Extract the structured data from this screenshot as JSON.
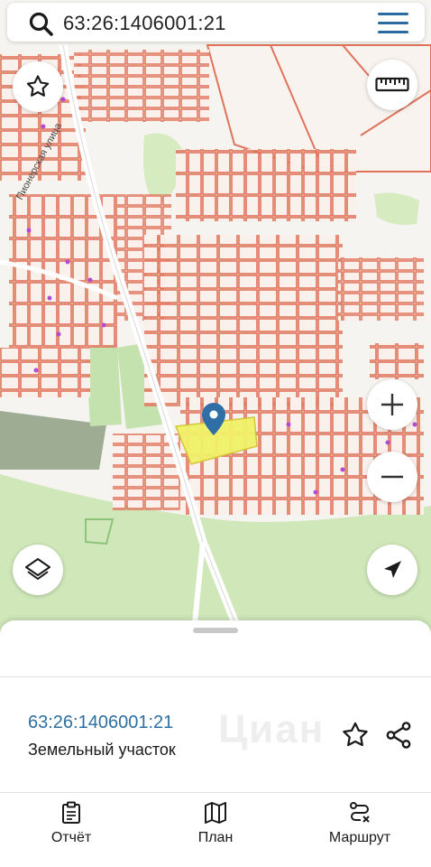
{
  "search": {
    "query": "63:26:1406001:21",
    "icon": "search-icon"
  },
  "map_controls": {
    "favorite_icon": "star-outline-icon",
    "ruler_icon": "ruler-icon",
    "zoom_in_icon": "plus-icon",
    "zoom_out_icon": "minus-icon",
    "layers_icon": "layers-icon",
    "locate_icon": "navigation-arrow-icon"
  },
  "map": {
    "street_label": "Пионерская улица",
    "colors": {
      "parcel_border": "#e0735a",
      "land": "#f6f4f1",
      "forest": "#cfe7b9",
      "water_grey": "#9eac94",
      "selected_parcel": "#f1f26a",
      "marker": "#2f6fa6"
    }
  },
  "parcel": {
    "cadastral_number": "63:26:1406001:21",
    "type": "Земельный участок",
    "watermark": "Циан"
  },
  "bottom_nav": [
    {
      "label": "Отчёт",
      "icon": "report-icon"
    },
    {
      "label": "План",
      "icon": "map-plan-icon"
    },
    {
      "label": "Маршрут",
      "icon": "route-icon"
    }
  ]
}
